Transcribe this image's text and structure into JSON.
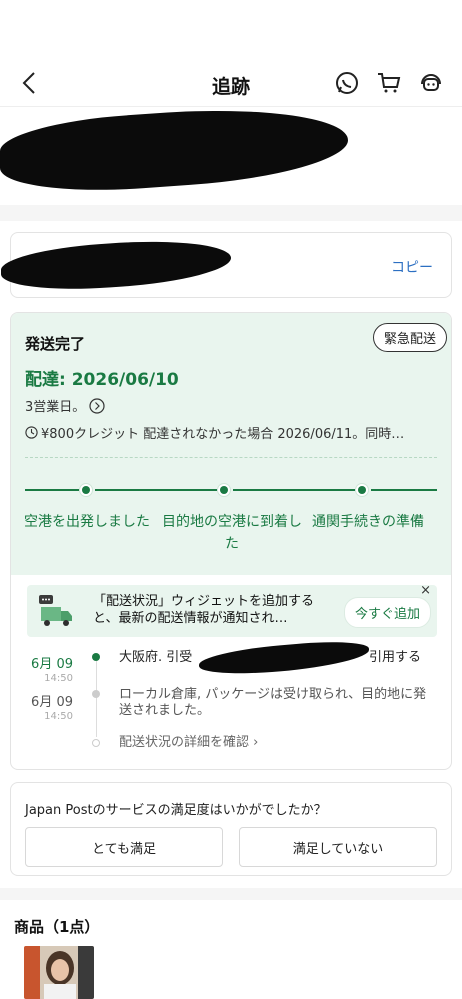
{
  "header": {
    "title": "追跡",
    "back_icon": "chevron-left-icon",
    "right_icons": [
      "whatsapp-icon",
      "cart-icon",
      "customer-service-icon"
    ]
  },
  "tracking": {
    "copy_label": "コピー"
  },
  "status": {
    "badge": "緊急配送",
    "title": "発送完了",
    "delivery": "配達: 2026/06/10",
    "business_days": "3営業日。",
    "credit_notice": "¥800クレジット 配達されなかった場合 2026/06/11。同時…",
    "steps": [
      {
        "label": "空港を出発しました"
      },
      {
        "label": "目的地の空港に到着した"
      },
      {
        "label": "通関手続きの準備"
      }
    ]
  },
  "widget": {
    "text": "「配送状況」ウィジェットを追加すると、最新の配送情報が通知され…",
    "button": "今すぐ追加",
    "close": "×"
  },
  "events": [
    {
      "date": "6月 09",
      "time": "14:50",
      "text_start": "大阪府. 引受",
      "text_end": "引用する",
      "active": true
    },
    {
      "date": "6月 09",
      "time": "14:50",
      "text": "ローカル倉庫, パッケージは受け取られ、目的地に発送されました。",
      "active": false
    }
  ],
  "details_link": "配送状況の詳細を確認 ›",
  "survey": {
    "question": "Japan Postのサービスの満足度はいかがでしたか？",
    "yes": "とても満足",
    "no": "満足していない"
  },
  "products": {
    "title": "商品（1点）"
  },
  "colors": {
    "accent_green": "#1a7a43",
    "status_bg": "#e9f5ee",
    "link_blue": "#2c6fc2"
  }
}
